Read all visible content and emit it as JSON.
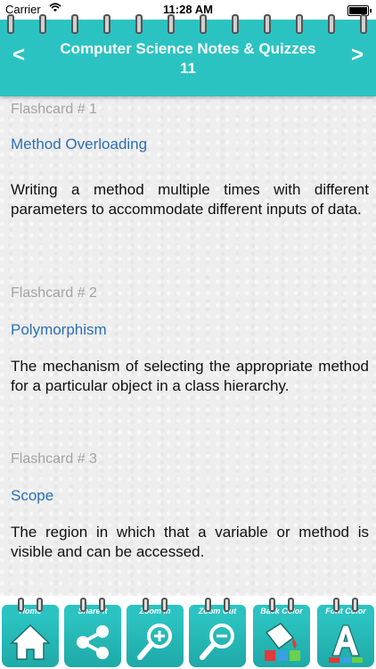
{
  "status_bar": {
    "carrier": "Carrier",
    "time": "11:28 AM"
  },
  "header": {
    "title_line1": "Computer Science Notes & Quizzes",
    "title_line2": "11",
    "prev_label": "<",
    "next_label": ">"
  },
  "flashcards": [
    {
      "number": "Flashcard # 1",
      "term": "Method Overloading",
      "definition": "Writing a method multiple times with different parameters to accommodate different inputs of data."
    },
    {
      "number": "Flashcard # 2",
      "term": "Polymorphism",
      "definition": "The mechanism of selecting the appropriate method for a particular object in a class hierarchy."
    },
    {
      "number": "Flashcard # 3",
      "term": "Scope",
      "definition": "The region in which that a variable or method is visible and can be accessed."
    }
  ],
  "toolbar": {
    "home": "Home",
    "share": "Share it",
    "zoom_in": "Zoom In",
    "zoom_out": "Zoom Out",
    "back_color": "Back Color",
    "font_color": "Font Color"
  },
  "colors": {
    "accent": "#2bc3c1",
    "term": "#2b6fb5",
    "number": "#a3a3a3"
  }
}
